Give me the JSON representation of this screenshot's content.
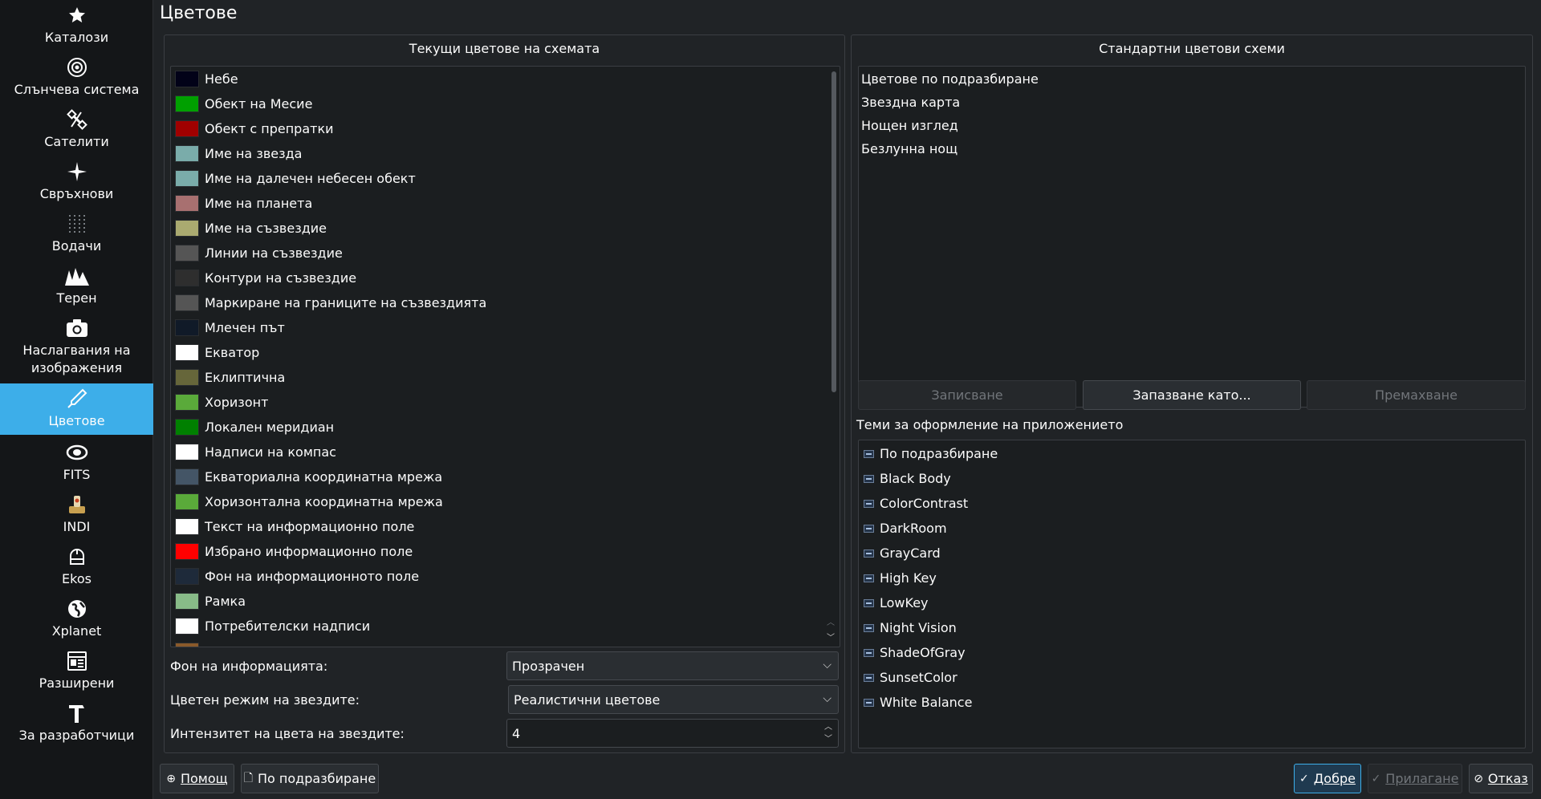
{
  "window": {
    "title": "Цветове"
  },
  "sidebar": {
    "items": [
      {
        "label": "Каталози",
        "icon": "star-icon"
      },
      {
        "label": "Слънчева система",
        "icon": "target-icon"
      },
      {
        "label": "Сателити",
        "icon": "satellite-icon"
      },
      {
        "label": "Свръхнови",
        "icon": "sparkle-icon"
      },
      {
        "label": "Водачи",
        "icon": "grid-dots-icon"
      },
      {
        "label": "Терен",
        "icon": "mountain-icon"
      },
      {
        "label": "Наслагвания на изображения",
        "icon": "camera-icon"
      },
      {
        "label": "Цветове",
        "icon": "color-picker-icon"
      },
      {
        "label": "FITS",
        "icon": "galaxy-icon"
      },
      {
        "label": "INDI",
        "icon": "indi-icon"
      },
      {
        "label": "Ekos",
        "icon": "ekos-icon"
      },
      {
        "label": "Xplanet",
        "icon": "globe-icon"
      },
      {
        "label": "Разширени",
        "icon": "advanced-icon"
      },
      {
        "label": "За разработчици",
        "icon": "hammer-icon"
      }
    ]
  },
  "current_colors": {
    "title": "Текущи цветове на схемата",
    "items": [
      {
        "label": "Небе",
        "color": "#020218"
      },
      {
        "label": "Обект на Месие",
        "color": "#00a000"
      },
      {
        "label": "Обект с препратки",
        "color": "#a00000"
      },
      {
        "label": "Име на звезда",
        "color": "#7aacaa"
      },
      {
        "label": "Име на далечен небесен обект",
        "color": "#7aacaa"
      },
      {
        "label": "Име на планета",
        "color": "#a87070"
      },
      {
        "label": "Име на съзвездие",
        "color": "#aaaa70"
      },
      {
        "label": "Линии на съзвездие",
        "color": "#555555"
      },
      {
        "label": "Контури на съзвездие",
        "color": "#2e2e2e"
      },
      {
        "label": "Маркиране на границите на съзвездията",
        "color": "#555555"
      },
      {
        "label": "Млечен път",
        "color": "#101a28"
      },
      {
        "label": "Екватор",
        "color": "#ffffff"
      },
      {
        "label": "Еклиптична",
        "color": "#66663a"
      },
      {
        "label": "Хоризонт",
        "color": "#5aaa3a"
      },
      {
        "label": "Локален меридиан",
        "color": "#008000"
      },
      {
        "label": "Надписи на компас",
        "color": "#ffffff"
      },
      {
        "label": "Екваториална координатна мрежа",
        "color": "#445566"
      },
      {
        "label": "Хоризонтална координатна мрежа",
        "color": "#5aaa3a"
      },
      {
        "label": "Текст на информационно поле",
        "color": "#ffffff"
      },
      {
        "label": "Избрано информационно поле",
        "color": "#ff0000"
      },
      {
        "label": "Фон на информационното поле",
        "color": "#1e2a3a"
      },
      {
        "label": "Рамка",
        "color": "#88bb88"
      },
      {
        "label": "Потребителски надписи",
        "color": "#ffffff"
      },
      {
        "label": "",
        "color": "#8a5a2a"
      }
    ]
  },
  "form": {
    "info_bg_label": "Фон на информацията:",
    "info_bg_value": "Прозрачен",
    "star_color_mode_label": "Цветен режим на звездите:",
    "star_color_mode_value": "Реалистични цветове",
    "star_intensity_label": "Интензитет на цвета на звездите:",
    "star_intensity_value": "4"
  },
  "standard_schemes": {
    "title": "Стандартни цветови схеми",
    "items": [
      "Цветове по подразбиране",
      "Звездна карта",
      "Нощен изглед",
      "Безлунна нощ"
    ],
    "save_label": "Записване",
    "save_as_label": "Запазване като...",
    "remove_label": "Премахване"
  },
  "themes": {
    "title": "Теми за оформление на приложението",
    "items": [
      "По подразбиране",
      "Black Body",
      "ColorContrast",
      "DarkRoom",
      "GrayCard",
      "High Key",
      "LowKey",
      "Night Vision",
      "ShadeOfGray",
      "SunsetColor",
      "White Balance"
    ]
  },
  "footer": {
    "help_label": "Помощ",
    "defaults_label": "По подразбиране",
    "ok_label": "Добре",
    "apply_label": "Прилагане",
    "cancel_label": "Отказ"
  },
  "colors": {
    "accent": "#3daee9",
    "background": "#202326",
    "sidebar": "#141618"
  }
}
